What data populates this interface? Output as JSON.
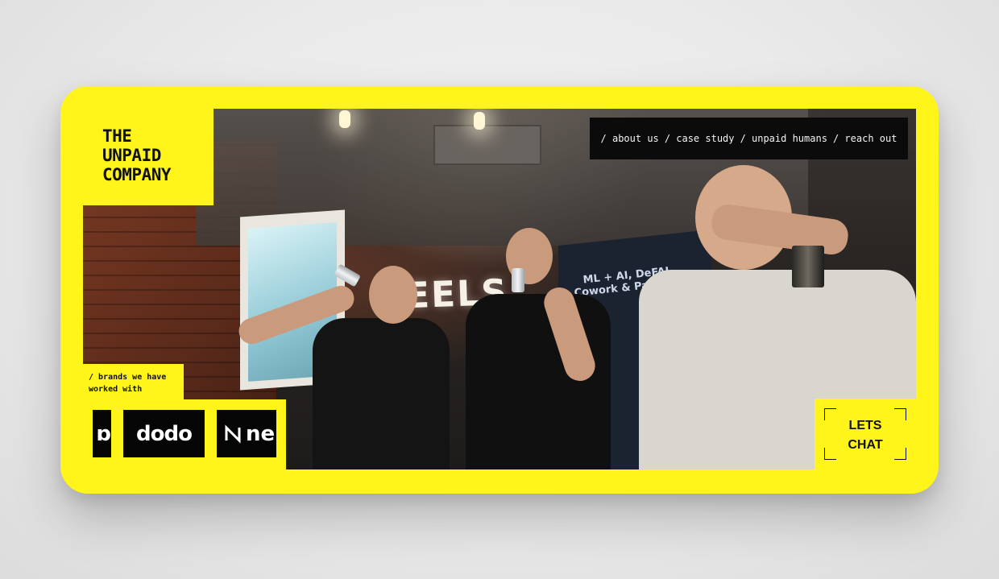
{
  "brand": {
    "logo_text": "THE\nUNPAID\nCOMPANY"
  },
  "nav": {
    "items": [
      {
        "label": "/ about us"
      },
      {
        "label": "/ case study"
      },
      {
        "label": "/ unpaid humans"
      },
      {
        "label": "/ reach out"
      }
    ]
  },
  "brands": {
    "label": "/ brands we have\nworked with",
    "tiles": [
      {
        "text": "ɒ",
        "icon": "partial-brand-logo-icon"
      },
      {
        "text": "dodo",
        "icon": "dodo-logo"
      },
      {
        "text": "ne",
        "icon": "near-logo"
      }
    ]
  },
  "cta": {
    "label": "LETS\nCHAT"
  },
  "video": {
    "sign_text": "EELS",
    "banner_text": "ML + AI, DeFAI\nCowork & Pavilion"
  },
  "colors": {
    "accent": "#fff51a",
    "dark": "#0b0b0b"
  }
}
